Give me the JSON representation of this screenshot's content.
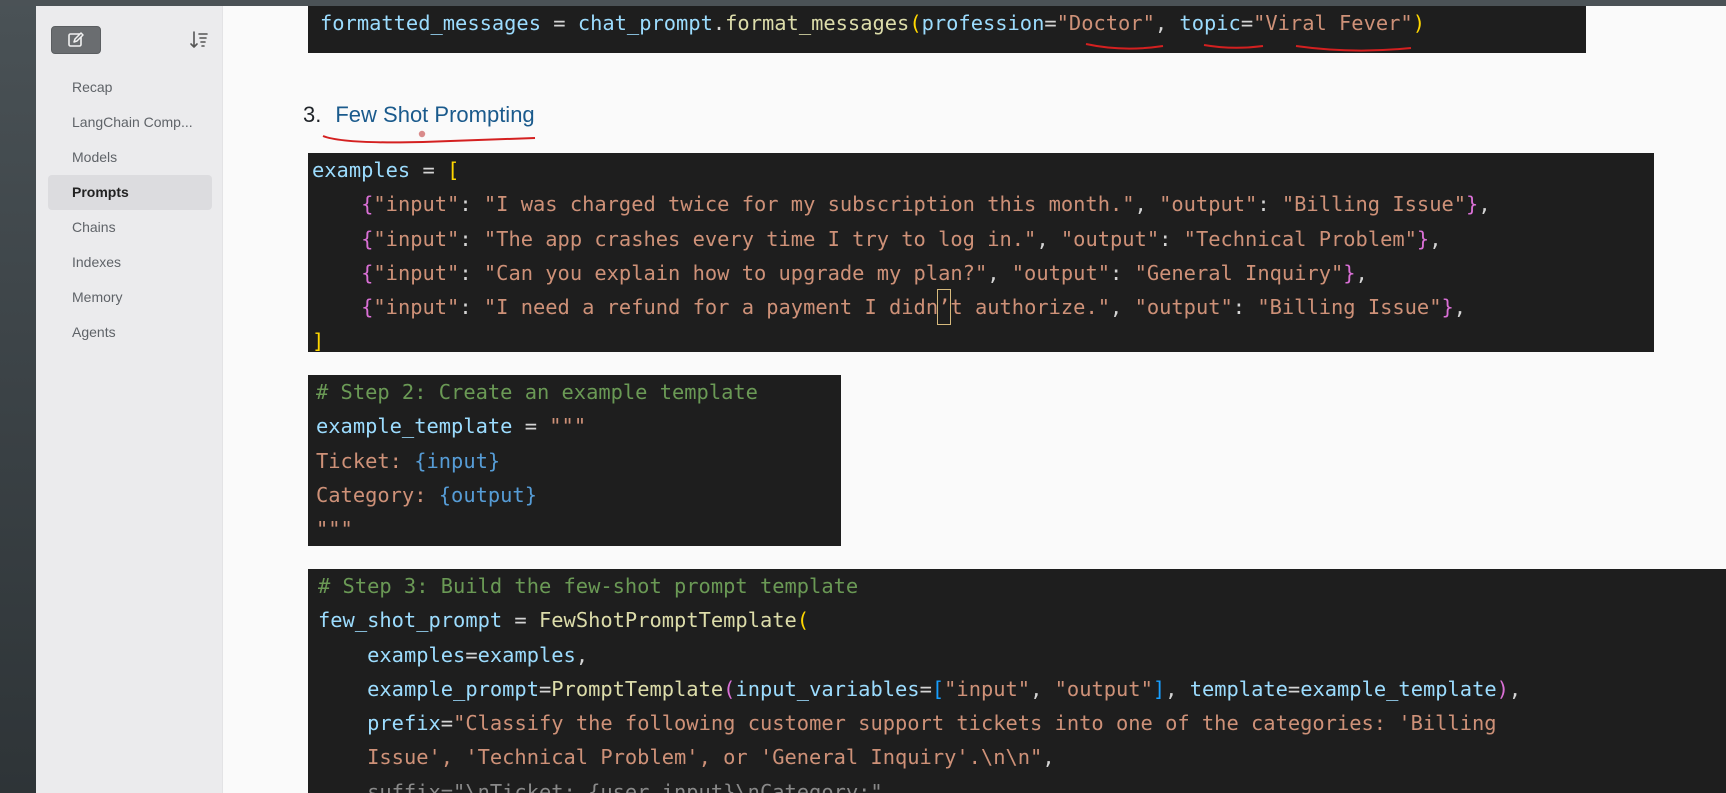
{
  "sidebar": {
    "items": [
      {
        "label": "Recap"
      },
      {
        "label": "LangChain Comp..."
      },
      {
        "label": "Models"
      },
      {
        "label": "Prompts"
      },
      {
        "label": "Chains"
      },
      {
        "label": "Indexes"
      },
      {
        "label": "Memory"
      },
      {
        "label": "Agents"
      }
    ],
    "active_item": "Prompts",
    "icons": {
      "new": "edit-note-icon",
      "sort": "sort-descending-icon"
    }
  },
  "code_top": {
    "var": "formatted_messages",
    "eq": " = ",
    "obj": "chat_prompt",
    "dot": ".",
    "fn": "format_messages",
    "open": "(",
    "arg1": "profession",
    "eq1": "=",
    "val1": "\"Doctor\"",
    "comma": ", ",
    "arg2": "topic",
    "eq2": "=",
    "val2": "\"Viral Fever\"",
    "close": ")"
  },
  "section": {
    "number": "3.",
    "title": "Few Shot Prompting"
  },
  "examples_block": {
    "head_var": "examples",
    "head_eq": " = ",
    "head_open": "[",
    "rows": [
      {
        "input": "\"I was charged twice for my subscription this month.\"",
        "output": "\"Billing Issue\""
      },
      {
        "input": "\"The app crashes every time I try to log in.\"",
        "output": "\"Technical Problem\""
      },
      {
        "input": "\"Can you explain how to upgrade my plan?\"",
        "output": "\"General Inquiry\""
      },
      {
        "input": "\"I need a refund for a payment I didn",
        "input_cursor_char": "’",
        "input_rest": "t authorize.\"",
        "output": "\"Billing Issue\""
      }
    ],
    "key_input": "\"input\"",
    "key_output": "\"output\"",
    "colon": ": ",
    "sep": ", ",
    "lbrace": "{",
    "rbrace": "}",
    "trail": ",",
    "close": "]"
  },
  "template_block": {
    "comment": "# Step 2: Create an example template",
    "var": "example_template",
    "eq": " = ",
    "triple": "\"\"\"",
    "line_ticket_label": "Ticket: ",
    "line_ticket_ph": "{input}",
    "line_category_label": "Category: ",
    "line_category_ph": "{output}",
    "end_triple": "\"\"\""
  },
  "fewshot_block": {
    "comment": "# Step 3: Build the few-shot prompt template",
    "var": "few_shot_prompt",
    "eq": " = ",
    "cls": "FewShotPromptTemplate",
    "open": "(",
    "l1_key": "examples",
    "l1_eq": "=",
    "l1_val": "examples",
    "l1_comma": ",",
    "l2_key": "example_prompt",
    "l2_eq": "=",
    "l2_cls": "PromptTemplate",
    "l2_open": "(",
    "l2_arg": "input_variables",
    "l2_eq2": "=",
    "l2_lb": "[",
    "l2_s1": "\"input\"",
    "l2_sep": ", ",
    "l2_s2": "\"output\"",
    "l2_rb": "]",
    "l2_mid": ", ",
    "l2_arg2": "template",
    "l2_eq3": "=",
    "l2_val2": "example_template",
    "l2_close": ")",
    "l2_comma": ",",
    "l3_key": "prefix",
    "l3_eq": "=",
    "l3_str": "\"Classify the following customer support tickets into one of the categories: 'Billing",
    "l4_str": "Issue', 'Technical Problem', or 'General Inquiry'.\\n\\n\"",
    "l4_comma": ",",
    "l5_partial": "    suffix=\"\\nTicket: {user_input}\\nCategory:\","
  },
  "colors": {
    "code_bg": "#1e1e1e",
    "annotation_red": "#d42020",
    "heading_blue": "#1a5a8c"
  }
}
